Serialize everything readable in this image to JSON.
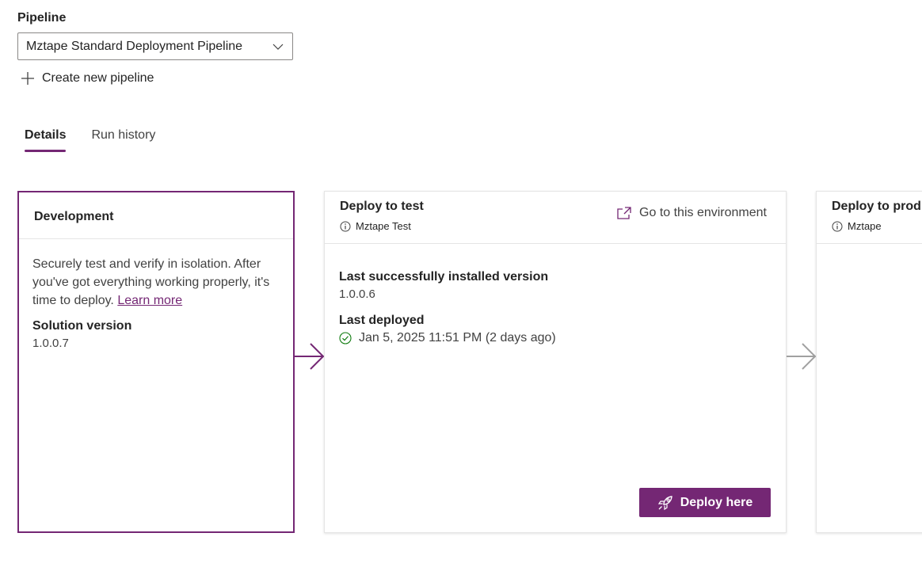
{
  "pipeline": {
    "label": "Pipeline",
    "selected": "Mztape Standard Deployment Pipeline",
    "create_label": "Create new pipeline"
  },
  "tabs": [
    {
      "label": "Details",
      "active": true
    },
    {
      "label": "Run history",
      "active": false
    }
  ],
  "development": {
    "title": "Development",
    "description": "Securely test and verify in isolation. After you've got everything working properly, it's time to deploy.",
    "learn_more": "Learn more",
    "solution_version_label": "Solution version",
    "solution_version": "1.0.0.7"
  },
  "test_stage": {
    "title": "Deploy to test",
    "environment": "Mztape Test",
    "goto_label": "Go to this environment",
    "installed_label": "Last successfully installed version",
    "installed_version": "1.0.0.6",
    "deployed_label": "Last deployed",
    "deployed_value": "Jan 5, 2025 11:51 PM (2 days ago)",
    "deploy_button": "Deploy here"
  },
  "prod_stage": {
    "title": "Deploy to prod",
    "environment": "Mztape"
  },
  "colors": {
    "accent": "#742774",
    "success": "#107c10",
    "arrow_inactive": "#a0a0a0"
  },
  "icons": {
    "dropdown": "chevron-down-icon",
    "create": "plus-icon",
    "environment": "info-icon",
    "goto": "open-external-icon",
    "deployed": "checkmark-circle-icon",
    "deploy": "rocket-icon",
    "flow": "arrow-right-icon"
  }
}
